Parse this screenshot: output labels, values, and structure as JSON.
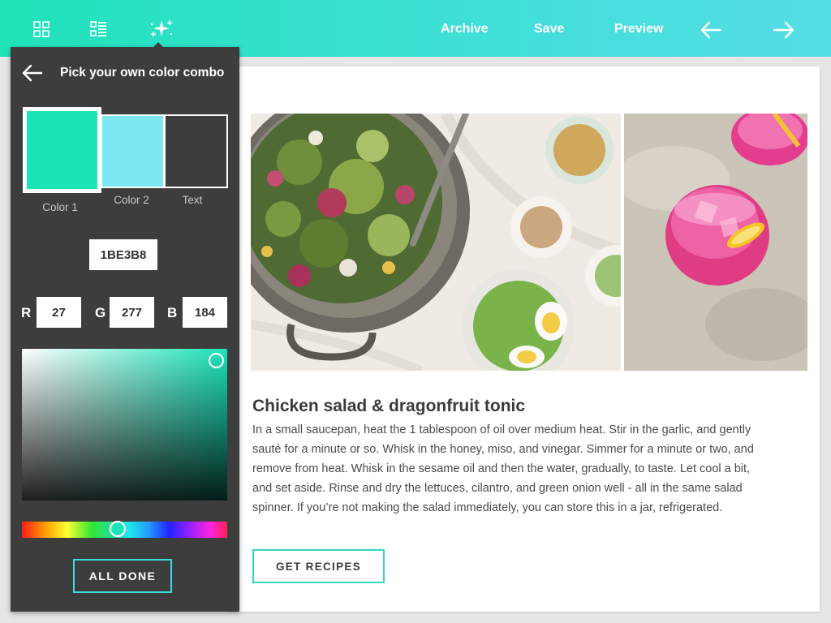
{
  "header": {
    "nav_links": [
      "Archive",
      "Save",
      "Preview"
    ],
    "icons": [
      "grid-icon",
      "list-icon",
      "sparkle-icon",
      "arrow-left-icon",
      "arrow-right-icon"
    ]
  },
  "panel": {
    "title": "Pick your own color combo",
    "swatches": [
      {
        "label": "Color 1",
        "color": "#1BE3B8"
      },
      {
        "label": "Color 2",
        "color": "#7EE8F2"
      },
      {
        "label": "Text",
        "color": "#3D3D3D"
      }
    ],
    "hex_value": "1BE3B8",
    "rgb": {
      "r_label": "R",
      "r_value": "27",
      "g_label": "G",
      "g_value": "277",
      "b_label": "B",
      "b_value": "184"
    },
    "done_label": "ALL DONE"
  },
  "recipe": {
    "title": "Chicken salad & dragonfruit tonic",
    "body": "In a small saucepan, heat the 1 tablespoon of oil over medium heat. Stir in the garlic, and gently sauté for a minute or so. Whisk in the honey, miso, and vinegar. Simmer for a minute or two, and remove from heat. Whisk in the sesame oil and then the water, gradually, to taste. Let cool a bit, and set aside. Rinse and dry the lettuces, cilantro, and green onion well - all in the same salad spinner. If you’re not making the salad immediately, you can store this in a jar, refrigerated.",
    "cta_label": "GET RECIPES"
  },
  "colors": {
    "accent": "#1BE3B8",
    "accent_light": "#55DDE6",
    "panel_bg": "#3D3D3D"
  }
}
